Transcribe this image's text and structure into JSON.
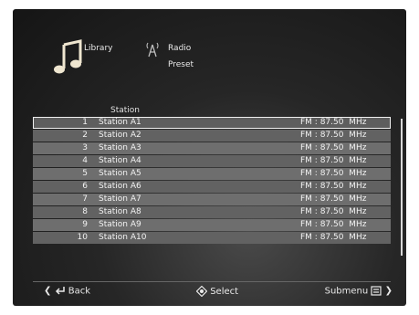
{
  "nav": {
    "library_label": "Library",
    "radio_label": "Radio",
    "preset_label": "Preset",
    "library_icon": "music-note-icon",
    "radio_icon": "radio-tower-icon"
  },
  "list": {
    "column_header": "Station",
    "selected_index": 0,
    "rows": [
      {
        "num": "1",
        "name": "Station A1",
        "freq": "FM : 87.50  MHz"
      },
      {
        "num": "2",
        "name": "Station A2",
        "freq": "FM : 87.50  MHz"
      },
      {
        "num": "3",
        "name": "Station A3",
        "freq": "FM : 87.50  MHz"
      },
      {
        "num": "4",
        "name": "Station A4",
        "freq": "FM : 87.50  MHz"
      },
      {
        "num": "5",
        "name": "Station A5",
        "freq": "FM : 87.50  MHz"
      },
      {
        "num": "6",
        "name": "Station A6",
        "freq": "FM : 87.50  MHz"
      },
      {
        "num": "7",
        "name": "Station A7",
        "freq": "FM : 87.50  MHz"
      },
      {
        "num": "8",
        "name": "Station A8",
        "freq": "FM : 87.50  MHz"
      },
      {
        "num": "9",
        "name": "Station A9",
        "freq": "FM : 87.50  MHz"
      },
      {
        "num": "10",
        "name": "Station A10",
        "freq": "FM : 87.50  MHz"
      }
    ]
  },
  "footer": {
    "back_label": "Back",
    "select_label": "Select",
    "submenu_label": "Submenu"
  },
  "colors": {
    "background": "#1c1c1c",
    "row": "#6e6e6e",
    "text": "#f2f2f2"
  }
}
